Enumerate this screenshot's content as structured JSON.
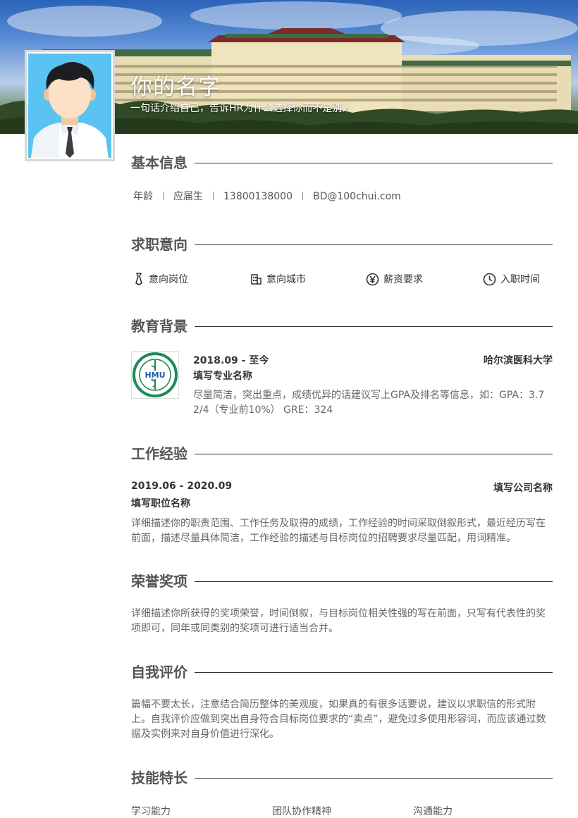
{
  "header": {
    "name": "你的名字",
    "tagline": "一句话介绍自己，告诉HR为什么选择你而不是别人"
  },
  "sections": {
    "basic": {
      "title": "基本信息",
      "items": [
        "年龄",
        "应届生",
        "13800138000",
        "BD@100chui.com"
      ]
    },
    "intent": {
      "title": "求职意向",
      "items": [
        {
          "icon": "tie-icon",
          "label": "意向岗位"
        },
        {
          "icon": "building-icon",
          "label": "意向城市"
        },
        {
          "icon": "yen-icon",
          "label": "薪资要求"
        },
        {
          "icon": "clock-icon",
          "label": "入职时间"
        }
      ]
    },
    "education": {
      "title": "教育背景",
      "period": "2018.09 - 至今",
      "school": "哈尔滨医科大学",
      "major": "填写专业名称",
      "desc": "尽量简洁，突出重点，成绩优异的话建议写上GPA及排名等信息，如：GPA：3.72/4（专业前10%） GRE：324",
      "logo_text": "HMU"
    },
    "work": {
      "title": "工作经验",
      "period": "2019.06 - 2020.09",
      "company": "填写公司名称",
      "position": "填写职位名称",
      "desc": "详细描述你的职责范围、工作任务及取得的成绩，工作经验的时间采取倒叙形式，最近经历写在前面，描述尽量具体简洁，工作经验的描述与目标岗位的招聘要求尽量匹配，用词精准。"
    },
    "honors": {
      "title": "荣誉奖项",
      "desc": "详细描述你所获得的奖项荣誉，时间倒叙，与目标岗位相关性强的写在前面，只写有代表性的奖项即可，同年或同类别的奖项可进行适当合并。"
    },
    "self": {
      "title": "自我评价",
      "desc": "篇幅不要太长，注意结合简历整体的美观度，如果真的有很多话要说，建议以求职信的形式附上。自我评价应做到突出自身符合目标岗位要求的“卖点”，避免过多使用形容词，而应该通过数据及实例来对自身价值进行深化。"
    },
    "skills": {
      "title": "技能特长",
      "items": [
        "学习能力",
        "团队协作精神",
        "沟通能力"
      ]
    }
  },
  "colors": {
    "title_text": "#555555",
    "body_text": "#666666",
    "rule_line": "#333333"
  }
}
